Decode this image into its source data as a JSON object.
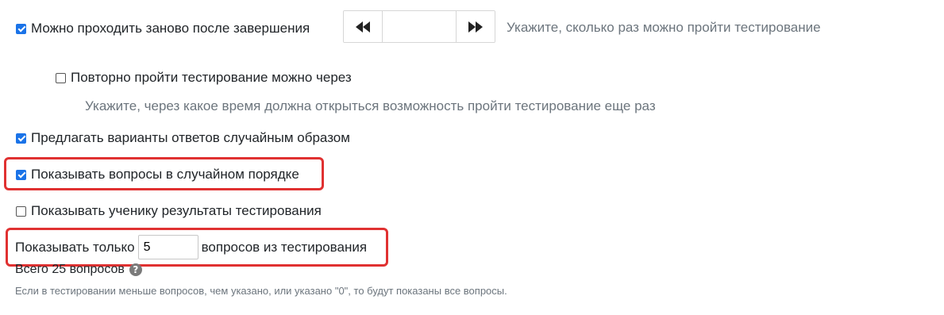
{
  "retake": {
    "checked": true,
    "label": "Можно проходить заново после завершения",
    "stepper_value": "",
    "hint": "Укажите, сколько раз можно пройти тестирование"
  },
  "retake_after": {
    "checked": false,
    "label": "Повторно пройти тестирование можно через",
    "hint": "Укажите, через какое время должна открыться возможность пройти тестирование еще раз"
  },
  "random_answers": {
    "checked": true,
    "label": "Предлагать варианты ответов случайным образом"
  },
  "random_questions": {
    "checked": true,
    "label": "Показывать вопросы в случайном порядке"
  },
  "show_results": {
    "checked": false,
    "label": "Показывать ученику результаты тестирования"
  },
  "limit": {
    "prefix": "Показывать только",
    "value": "5",
    "suffix": "вопросов из тестирования",
    "total": "Всего 25 вопросов",
    "help_glyph": "?",
    "note": "Если в тестировании меньше вопросов, чем указано, или указано \"0\", то будут показаны все вопросы."
  },
  "colors": {
    "accent": "#1a73e8",
    "highlight": "#e03131",
    "muted": "#6c757d"
  },
  "icons": {
    "rewind": "rewind-icon",
    "fast_forward": "fast-forward-icon",
    "help": "question-circle-icon"
  }
}
